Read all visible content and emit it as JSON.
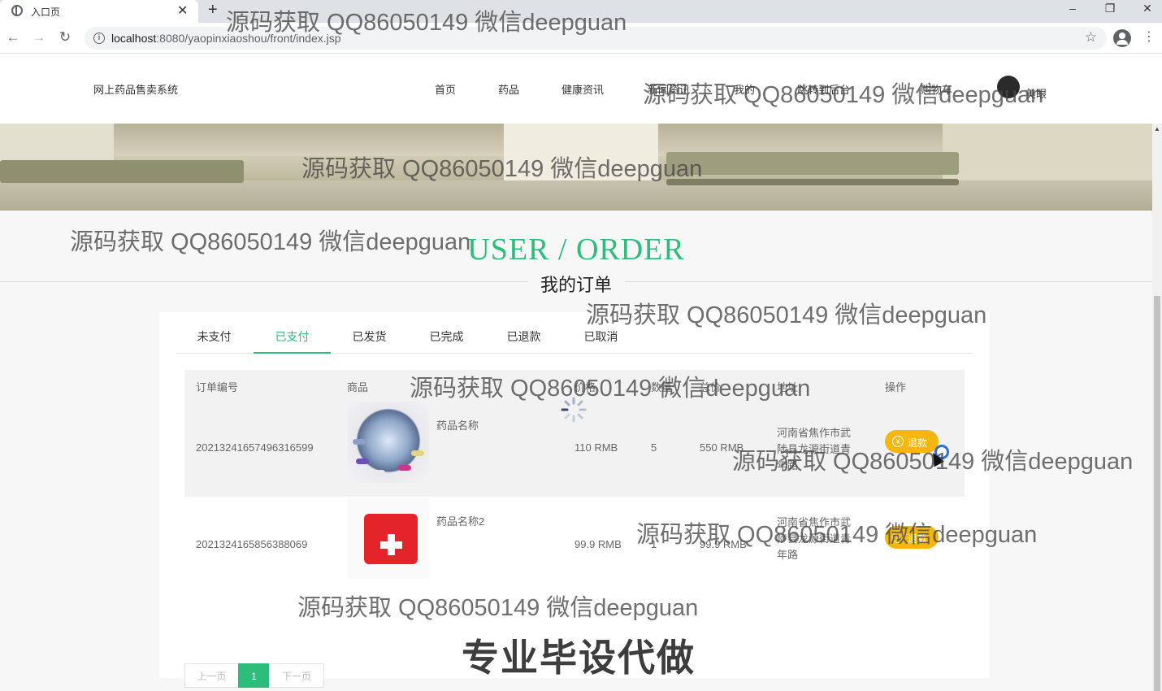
{
  "browser": {
    "tab_title": "入口页",
    "tab_close": "✕",
    "new_tab": "+",
    "url_host": "localhost",
    "url_rest": ":8080/yaopinxiaoshou/front/index.jsp",
    "window_controls": [
      "–",
      "❐",
      "✕"
    ]
  },
  "site": {
    "title": "网上药品售卖系统",
    "nav": [
      "首页",
      "药品",
      "健康资讯",
      "新闻资讯",
      "我的",
      "跳转到后台",
      "购物车"
    ],
    "username": "美眼"
  },
  "section": {
    "title": "USER / ORDER",
    "subtitle": "我的订单"
  },
  "order_tabs": {
    "items": [
      "未支付",
      "已支付",
      "已发货",
      "已完成",
      "已退款",
      "已取消"
    ],
    "active": "已支付"
  },
  "table": {
    "headers": [
      "订单编号",
      "商品",
      "价格",
      "数量",
      "总价",
      "地址",
      "操作"
    ],
    "rows": [
      {
        "order_no": "20213241657496316599",
        "product": "药品名称",
        "price": "110 RMB",
        "qty": "5",
        "total": "550 RMB",
        "address": [
          "河南省焦作市武",
          "陟县龙源街道青",
          "年路"
        ],
        "action": "退款"
      },
      {
        "order_no": "2021324165856388069",
        "product": "药品名称2",
        "price": "99.9 RMB",
        "qty": "1",
        "total": "99.9 RMB",
        "address": [
          "河南省焦作市武",
          "陟县龙源街道青",
          "年路"
        ],
        "action": "退款"
      }
    ]
  },
  "pager": {
    "prev": "上一页",
    "current": "1",
    "next": "下一页"
  },
  "icons": {
    "refund": "¥"
  },
  "watermarks": {
    "line": "源码获取 QQ86050149 微信deepguan",
    "banner_text": "专业毕设代做"
  },
  "colors": {
    "accent": "#2ebc7b",
    "refund_button": "#f5b60d"
  }
}
